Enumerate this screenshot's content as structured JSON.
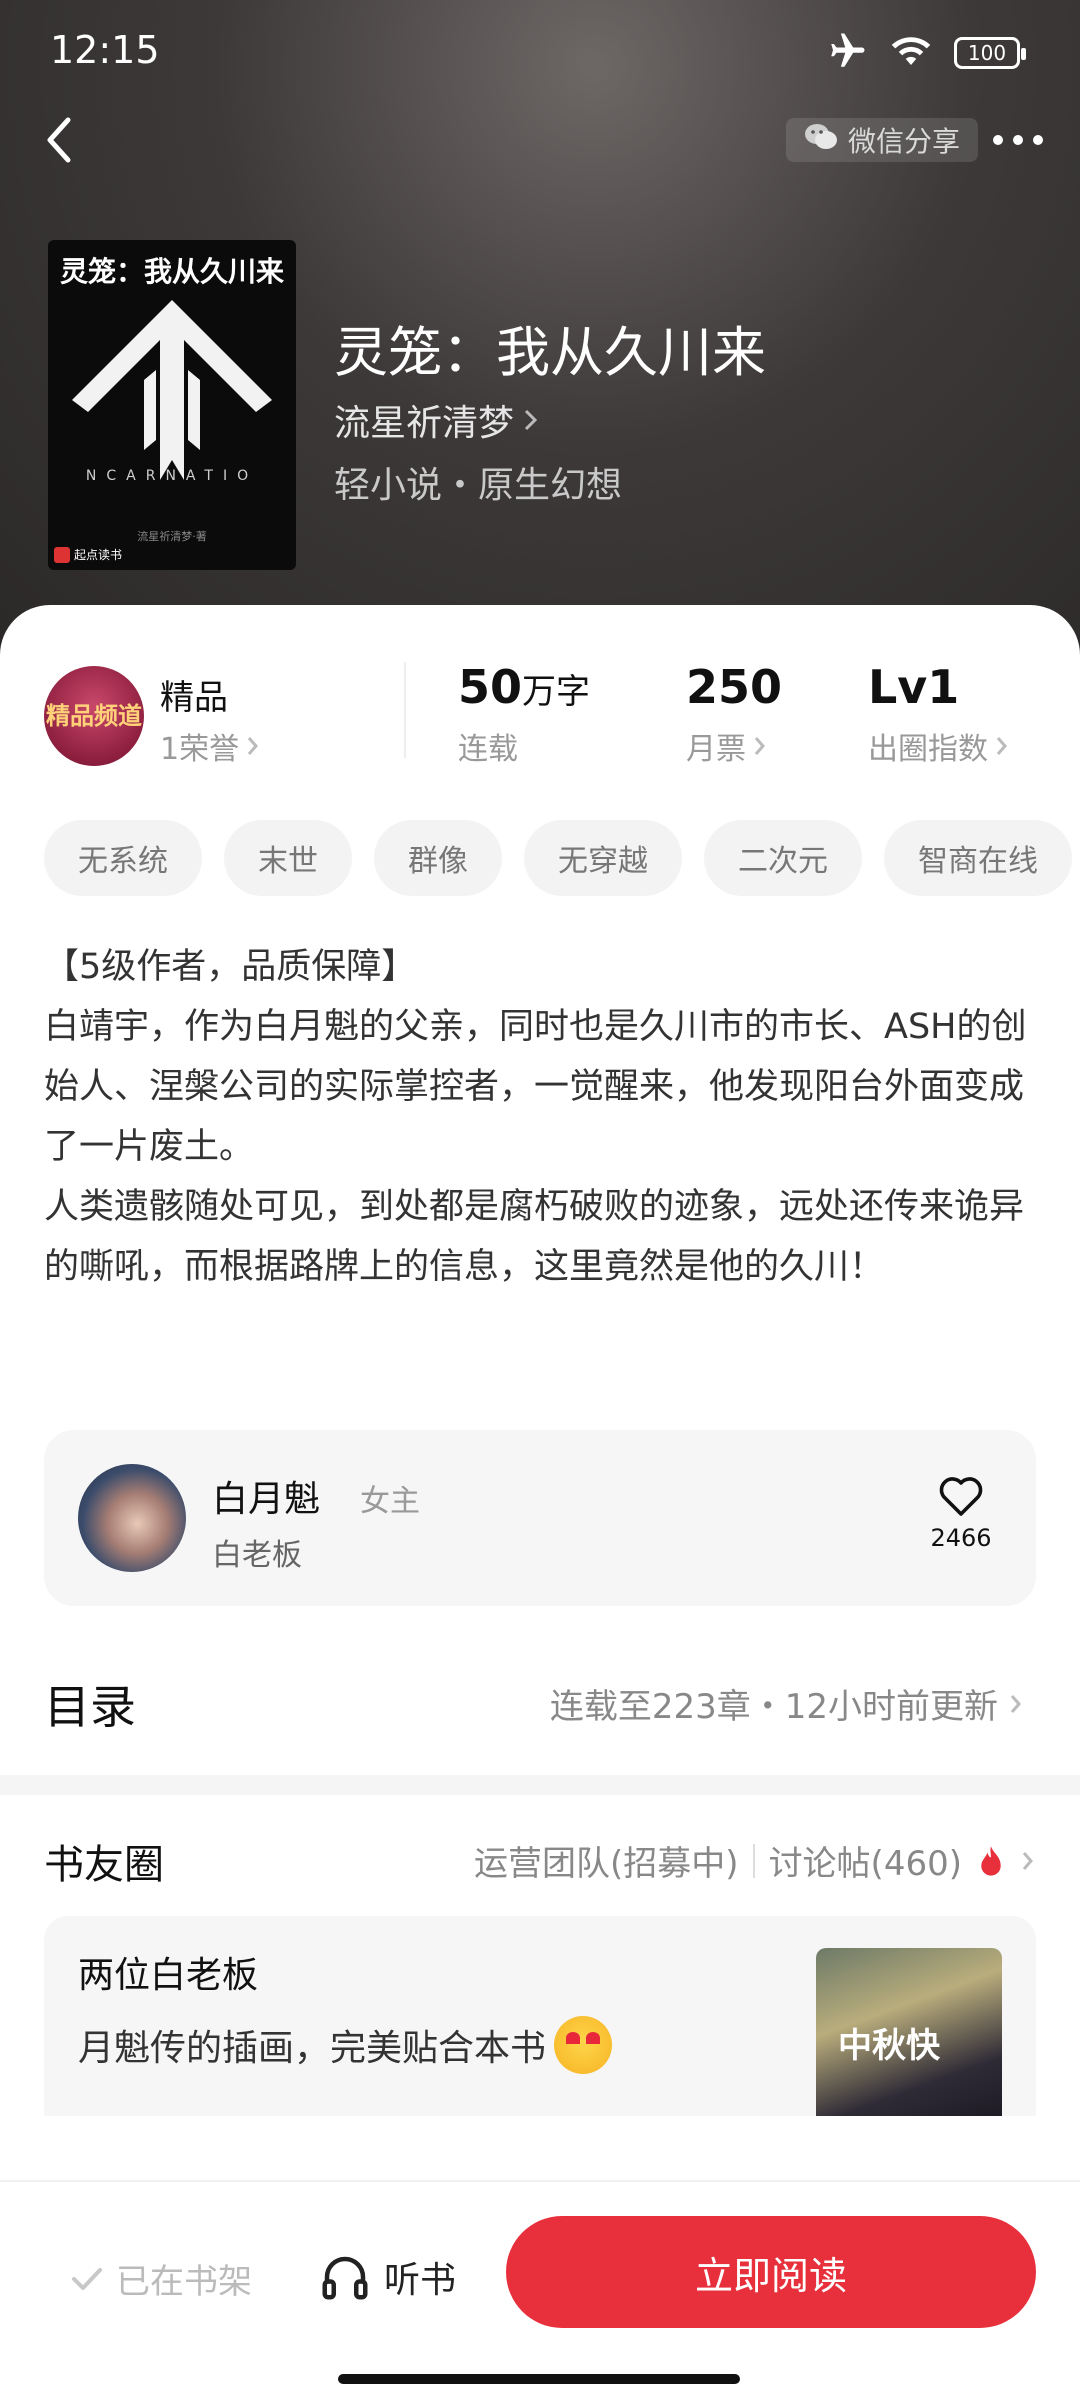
{
  "status": {
    "time": "12:15",
    "battery": "100"
  },
  "nav": {
    "share_label": "微信分享"
  },
  "cover": {
    "title": "灵笼：我从久川来",
    "subtitle": "NCARNATIO",
    "author": "流星祈清梦·著",
    "publisher": "起点读书"
  },
  "book": {
    "title": "灵笼：我从久川来",
    "author": "流星祈清梦",
    "genre": "轻小说・原生幻想"
  },
  "stats": {
    "honor": {
      "badge": "精品频道",
      "label": "精品",
      "sub": "1荣誉"
    },
    "words": {
      "value": "50",
      "unit": "万字",
      "sub": "连载"
    },
    "tickets": {
      "value": "250",
      "sub": "月票"
    },
    "level": {
      "value": "Lv1",
      "sub": "出圈指数"
    }
  },
  "tags": [
    "无系统",
    "末世",
    "群像",
    "无穿越",
    "二次元",
    "智商在线"
  ],
  "description": [
    "【5级作者，品质保障】",
    "白靖宇，作为白月魁的父亲，同时也是久川市的市长、ASH的创始人、涅槃公司的实际掌控者，一觉醒来，他发现阳台外面变成了一片废土。",
    "人类遗骸随处可见，到处都是腐朽破败的迹象，远处还传来诡异的嘶吼，而根据路牌上的信息，这里竟然是他的久川！"
  ],
  "role": {
    "name": "白月魁",
    "tag": "女主",
    "title": "白老板",
    "likes": "2466"
  },
  "toc": {
    "title": "目录",
    "info": "连载至223章・12小时前更新"
  },
  "circle": {
    "title": "书友圈",
    "team": "运营团队(招募中)",
    "posts": "讨论帖(460)"
  },
  "post": {
    "title": "两位白老板",
    "body": "月魁传的插画，完美贴合本书",
    "image_text": "中秋快"
  },
  "bottom": {
    "shelf": "已在书架",
    "listen": "听书",
    "read": "立即阅读"
  },
  "colors": {
    "accent": "#e8303d",
    "hero_bg": "#3d3939"
  }
}
